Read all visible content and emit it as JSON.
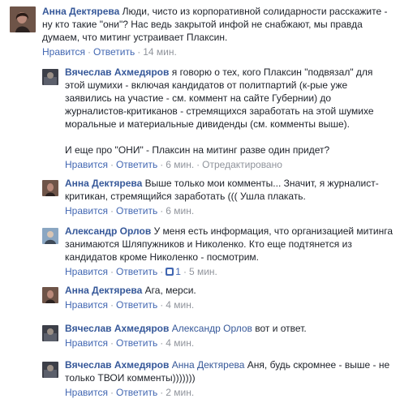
{
  "comments": [
    {
      "author": "Анна Дектярева",
      "text": "Люди, чисто из корпоративной солидарности расскажите - ну кто такие \"они\"? Нас ведь закрытой инфой не снабжают, мы правда думаем, что митинг устраивает Плаксин.",
      "like": "Нравится",
      "reply": "Ответить",
      "time": "14 мин."
    },
    {
      "author": "Вячеслав Ахмедяров",
      "text": "я говорю о тех, кого Плаксин \"подвязал\" для этой шумихи - включая кандидатов от политпартий (к-рые уже заявились на участие - см. коммент на сайте Губернии) до журналистов-критиканов - стремящихся заработать на этой шумихе моральные и материальные дивиденды (см. комменты выше).",
      "text2": "И еще про \"ОНИ\" - Плаксин на митинг разве один придет?",
      "like": "Нравится",
      "reply": "Ответить",
      "time": "6 мин.",
      "edited": "Отредактировано"
    },
    {
      "author": "Анна Дектярева",
      "text": "Выше только мои комменты... Значит, я журналист-критикан, стремящийся заработать ((( Ушла плакать.",
      "like": "Нравится",
      "reply": "Ответить",
      "time": "6 мин."
    },
    {
      "author": "Александр Орлов",
      "text": "У меня есть информация, что организацией митинга занимаются Шляпужников и Николенко. Кто еще подтянется из кандидатов кроме Николенко - посмотрим.",
      "like": "Нравится",
      "reply": "Ответить",
      "likes_count": "1",
      "time": "5 мин."
    },
    {
      "author": "Анна Дектярева",
      "text": "Ага, мерси.",
      "like": "Нравится",
      "reply": "Ответить",
      "time": "4 мин."
    },
    {
      "author": "Вячеслав Ахмедяров",
      "mention": "Александр Орлов",
      "text": "вот и ответ.",
      "like": "Нравится",
      "reply": "Ответить",
      "time": "4 мин."
    },
    {
      "author": "Вячеслав Ахмедяров",
      "mention": "Анна Дектярева",
      "text": "Аня, будь скромнее - выше - не только ТВОИ комменты)))))))",
      "like": "Нравится",
      "reply": "Ответить",
      "time": "2 мин."
    }
  ]
}
